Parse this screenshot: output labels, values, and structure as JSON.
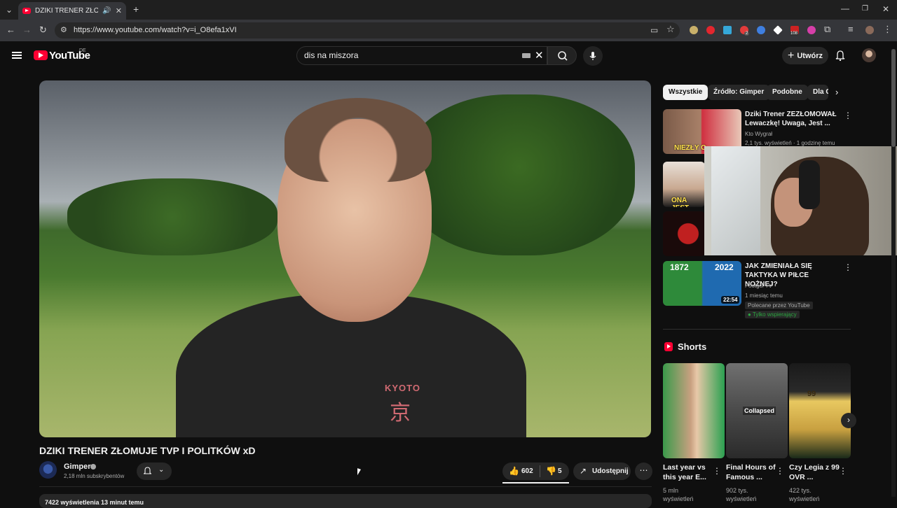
{
  "browser": {
    "tab_title": "DZIKI TRENER ZŁOMUJE TV",
    "url": "https://www.youtube.com/watch?v=i_O8efa1xVI",
    "new_tab_icon": "plus-icon",
    "ext_badge_count": "108",
    "ext_badge_small": "2"
  },
  "header": {
    "logo_text": "YouTube",
    "country": "DE",
    "search_value": "dis na miszora",
    "create_label": "Utwórz"
  },
  "video": {
    "title": "DZIKI TRENER ZŁOMUJE TVP I POLITKÓW xD",
    "shirt_text": "KYOTO",
    "shirt_kanji": "京",
    "channel_name": "Gimper",
    "subscribers": "2,18 mln subskrybentów",
    "likes": "602",
    "dislikes": "5",
    "share_label": "Udostępnij",
    "views_line": "7422 wyświetlenia  13 minut temu"
  },
  "sidebar": {
    "chips": [
      "Wszystkie",
      "Źródło: Gimper",
      "Podobne",
      "Dla Ciebie"
    ],
    "recommendations": [
      {
        "title": "Dziki Trener ZEZŁOMOWAŁ Lewaczkę! Uwaga, Jest ...",
        "channel": "Kto Wygrał",
        "meta": "2,1 tys. wyświetleń · 1 godzinę temu",
        "thumb_text": "NIEZŁY C"
      },
      {
        "title": "",
        "channel": "",
        "meta": "",
        "thumb_text": "ONA JEST"
      },
      {
        "title": "JAK ZMIENIAŁA SIĘ TAKTYKA W PIŁCE NOŻNEJ?",
        "channel": "Footgol TV",
        "meta": "1 miesiąc temu",
        "badge": "Polecane przez YouTube",
        "supporter": "Tylko wspierający",
        "duration": "22:54",
        "year_left": "1872",
        "year_right": "2022"
      }
    ],
    "shorts_heading": "Shorts",
    "shorts": [
      {
        "title": "Last year vs this year E...",
        "views": "5 mln",
        "suffix": "wyświetleń"
      },
      {
        "title": "Final Hours of Famous ...",
        "views": "902 tys.",
        "suffix": "wyświetleń",
        "overlay": "Collapsed"
      },
      {
        "title": "Czy Legia z 99 OVR ...",
        "views": "422 tys.",
        "suffix": "wyświetleń",
        "overlay": "99"
      }
    ]
  },
  "colors": {
    "background": "#0f0f0f",
    "accent": "#ff0033",
    "chip": "#272727"
  }
}
